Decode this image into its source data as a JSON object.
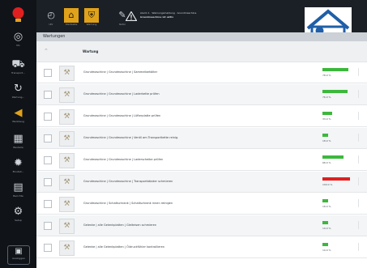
{
  "app": {
    "accent": "#e0a21b",
    "sidebar_bg": "#101418",
    "topbar_bg": "#1b2026"
  },
  "sidebar": {
    "items": [
      {
        "icon": "lightbulb-icon",
        "label": "",
        "color": "#e02020"
      },
      {
        "icon": "target-icon",
        "label": "Mo"
      },
      {
        "icon": "truck-icon",
        "label": "Transport..."
      },
      {
        "icon": "refresh-icon",
        "label": "Wartung..."
      },
      {
        "icon": "tag-icon",
        "label": "Werkzeug"
      },
      {
        "icon": "grid-icon",
        "label": "Bauteile"
      },
      {
        "icon": "gear-icon",
        "label": "Einstell..."
      },
      {
        "icon": "document-icon",
        "label": "Berichte"
      },
      {
        "icon": "settings-icon",
        "label": "Setup"
      }
    ],
    "bottom": {
      "icon": "tool-case-icon",
      "label": "Ausloggen"
    }
  },
  "topbar": {
    "buttons": [
      {
        "icon": "stopwatch-icon",
        "label": "Uhr"
      },
      {
        "icon": "home-icon",
        "label": "Startseite",
        "warn": true
      },
      {
        "icon": "shield-icon",
        "label": "Wartung",
        "warn": true
      },
      {
        "icon": "edit-icon",
        "label": "Notiz"
      }
    ],
    "alert_line1": "Alarm 1 · Warnungsmeldung · Grundmaschine",
    "alert_line2": "Grundmaschine ist aktiv"
  },
  "panel": {
    "title": "Wartungen"
  },
  "table": {
    "column_header": "Wartung",
    "rows": [
      {
        "text": "Grundmaschine | Grundmaschine | Sammelbehälter",
        "progress": 0.95,
        "value": "78.0 %",
        "color": "#3cb83c"
      },
      {
        "text": "Grundmaschine | Grundmaschine | Laderkette prüfen",
        "progress": 0.9,
        "value": "76.0 %",
        "color": "#3cb83c"
      },
      {
        "text": "Grundmaschine | Grundmaschine | Lüfterplatte prüfen",
        "progress": 0.35,
        "value": "33.0 %",
        "color": "#3cb83c"
      },
      {
        "text": "Grundmaschine | Grundmaschine | Ventil am Transportkette reinig.",
        "progress": 0.2,
        "value": "18.0 %",
        "color": "#3cb83c"
      },
      {
        "text": "Grundmaschine | Grundmaschine | Laderscheibe prüfen",
        "progress": 0.75,
        "value": "68.0 %",
        "color": "#3cb83c"
      },
      {
        "text": "Grundmaschine | Grundmaschine | Transportbänder schmieren",
        "progress": 1.0,
        "value": "100.0 %",
        "color": "#e02020"
      },
      {
        "text": "Grundmaschine | Schaltschrank | Schaltschrank innen reinigen",
        "progress": 0.2,
        "value": "18.0 %",
        "color": "#3cb83c"
      },
      {
        "text": "Gelenke | alle Gelenkplatten | Gleiteisen schmieren",
        "progress": 0.22,
        "value": "19.0 %",
        "color": "#3cb83c"
      },
      {
        "text": "Gelenke | alle Gelenkplatten | Öldruckfühler kontrollieren",
        "progress": 0.22,
        "value": "19.0 %",
        "color": "#3cb83c"
      }
    ]
  }
}
